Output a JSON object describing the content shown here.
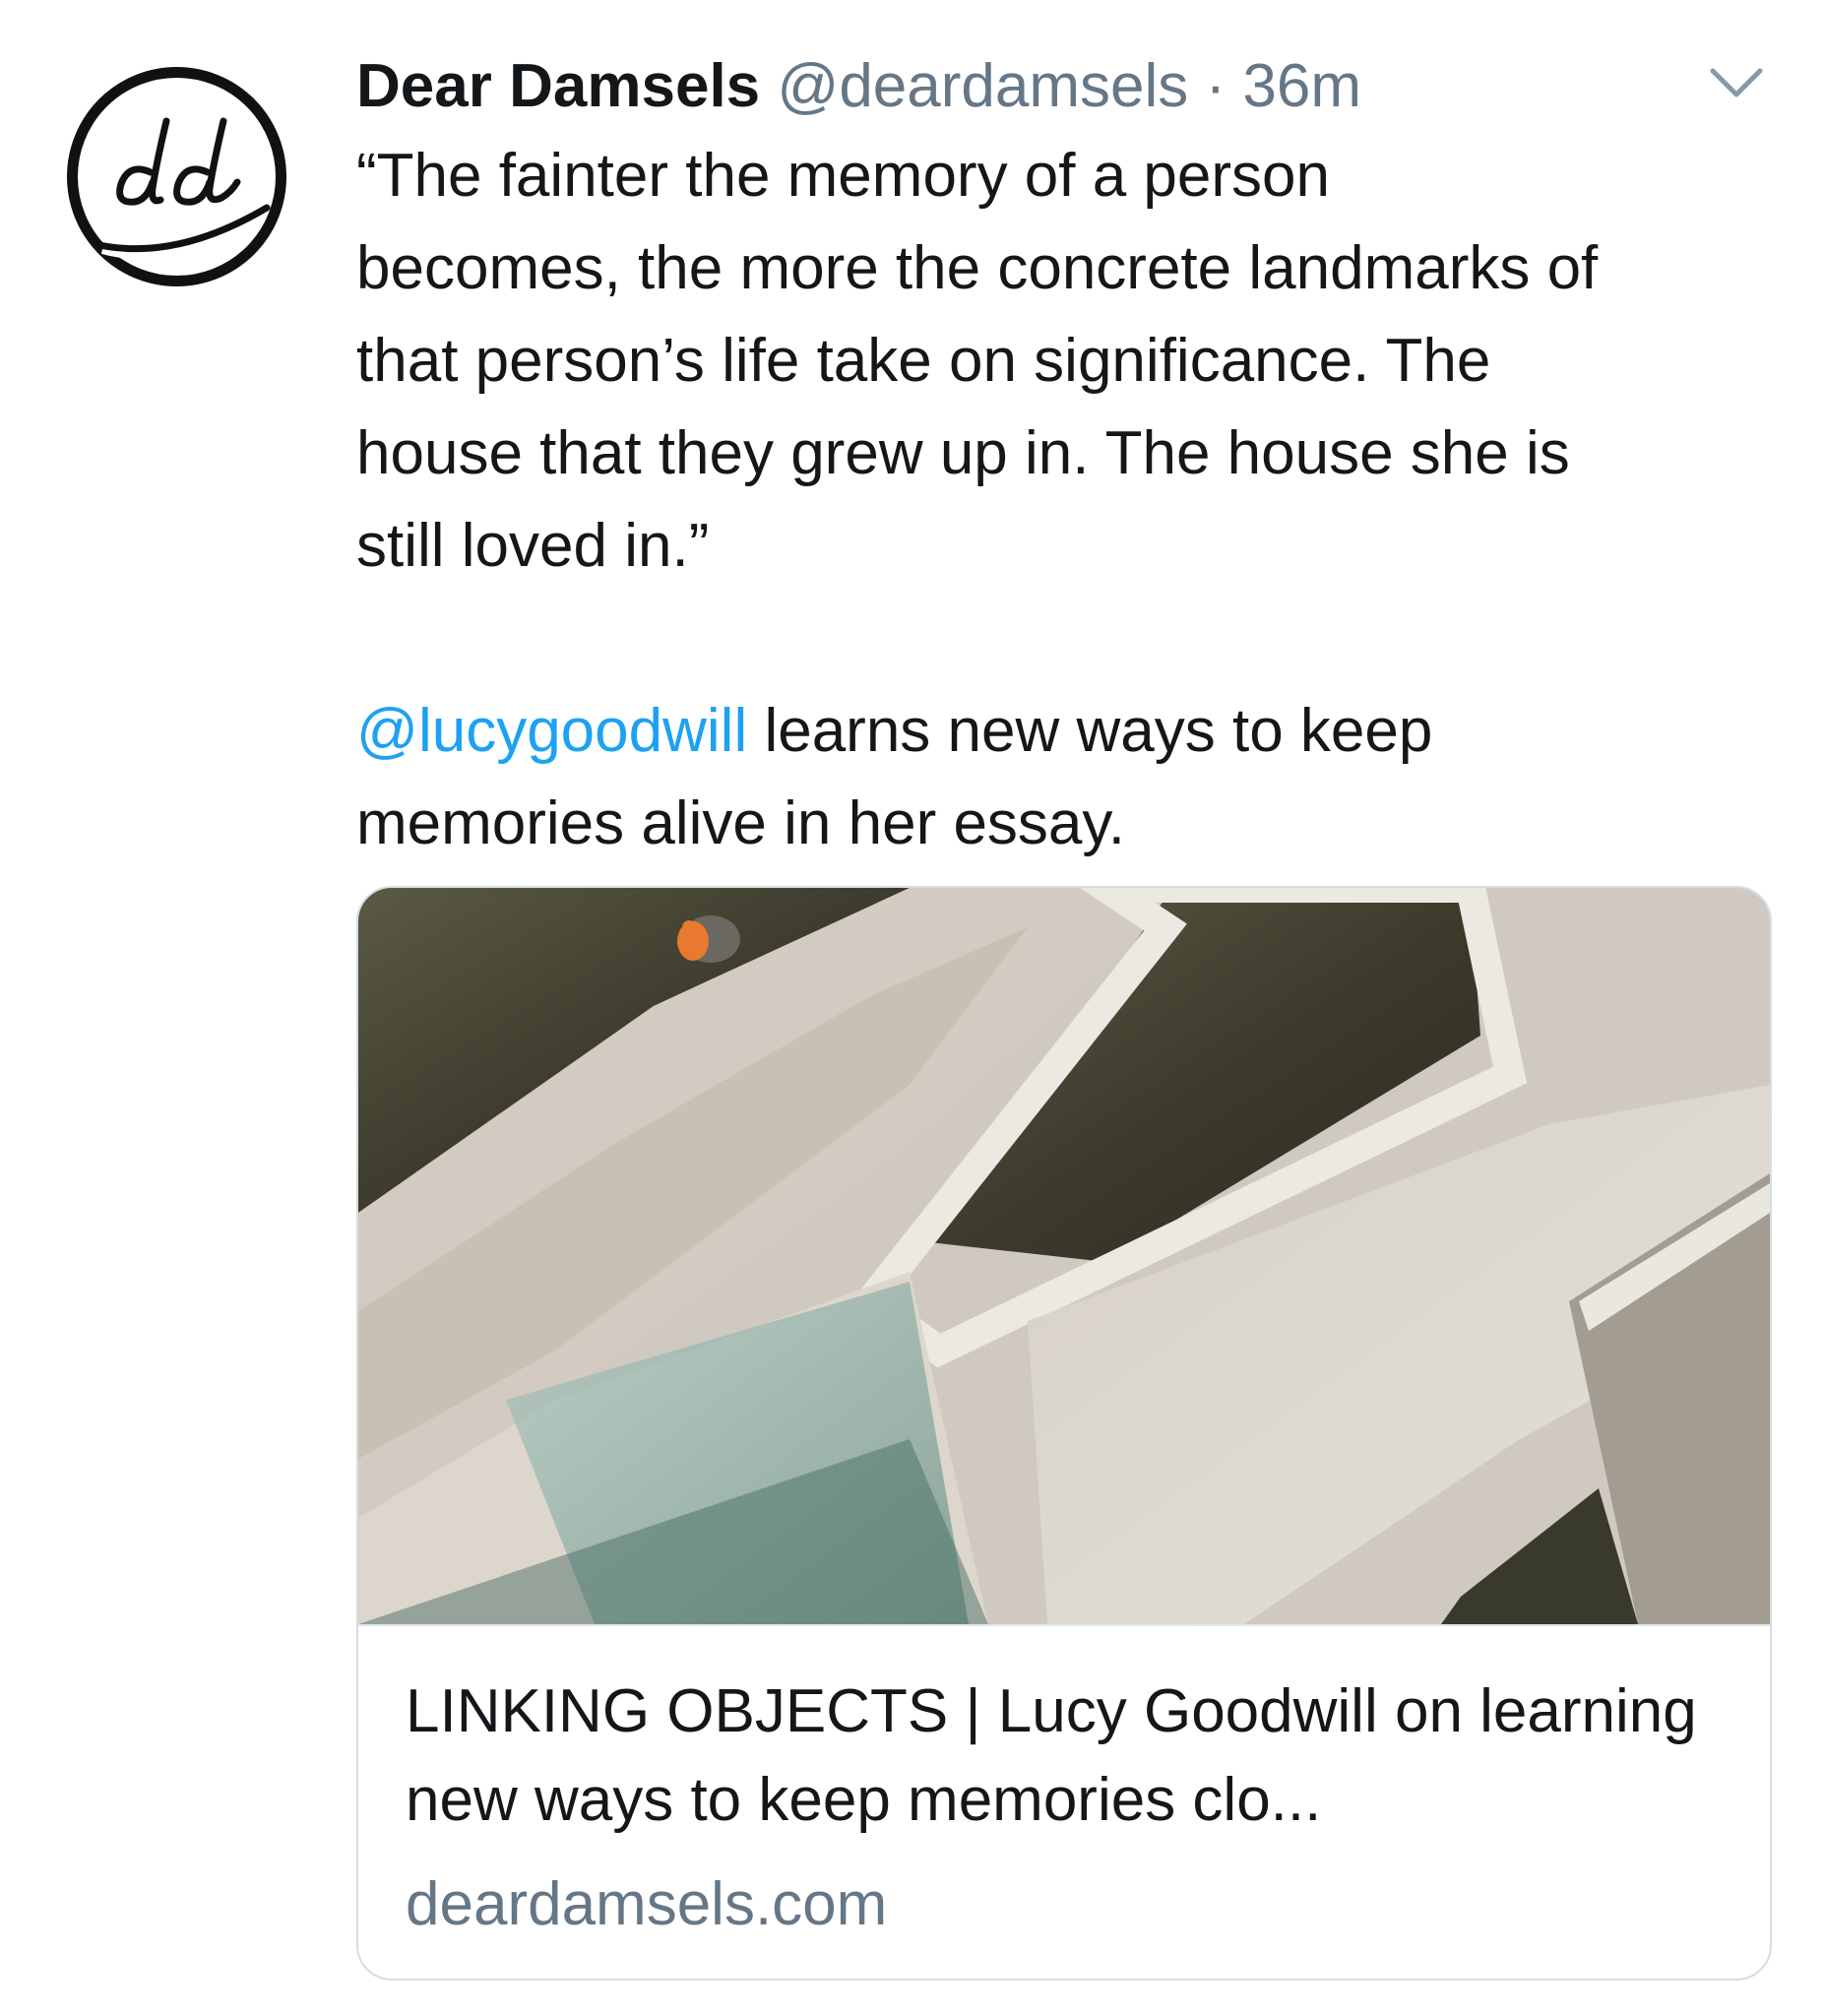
{
  "tweet": {
    "author": {
      "display_name": "Dear Damsels",
      "handle": "@deardamsels",
      "avatar_icon": "dd-logo-avatar"
    },
    "separator": "·",
    "time": "36m",
    "menu_icon": "chevron-down-icon",
    "text_lines": [
      "“The fainter the memory of a person",
      "becomes, the more the concrete landmarks of",
      "that person’s life take on significance. The",
      "house that they grew up in. The house she is",
      "still loved in.”"
    ],
    "mention": "@lucygoodwill",
    "text_after_mention": " learns new ways to keep",
    "text_last_line": "memories alive in her essay."
  },
  "card": {
    "title": "LINKING OBJECTS | Lucy Goodwill on learning new ways to keep memories clo...",
    "domain": "deardamsels.com"
  },
  "colors": {
    "text": "#14171a",
    "secondary": "#657786",
    "link": "#1da1f2",
    "border": "#d6dde3"
  }
}
